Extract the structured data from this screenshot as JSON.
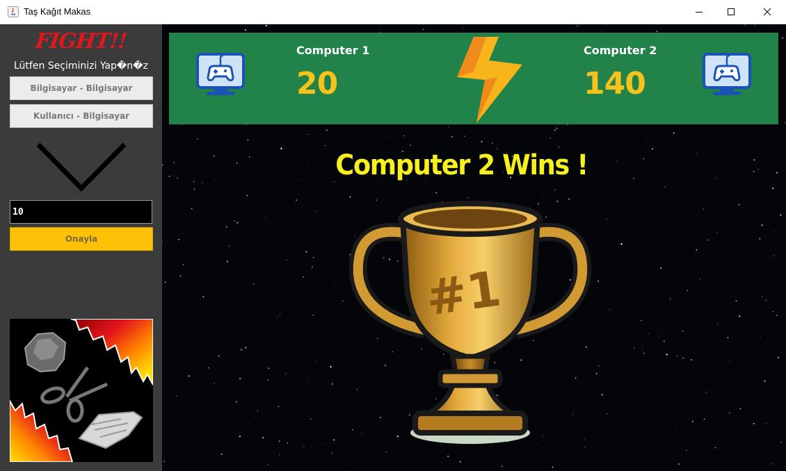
{
  "window": {
    "title": "Taş Kağıt Makas",
    "controls": [
      "minimize-icon",
      "maximize-icon",
      "close-icon"
    ]
  },
  "sidebar": {
    "fight_label": "FIGHT!!",
    "prompt": "Lütfen Seçiminizi Yap�n�z",
    "buttons": {
      "computer_vs_computer": "Bilgisayar - Bilgisayar",
      "user_vs_computer": "Kullanıcı - Bilgisayar"
    },
    "rounds_input": {
      "value": "10"
    },
    "confirm_label": "Onayla",
    "image_icon": "rock-scissors-paper-image"
  },
  "scoreboard": {
    "player1": {
      "name": "Computer 1",
      "score": "20",
      "icon": "monitor-gamepad-icon"
    },
    "player2": {
      "name": "Computer 2",
      "score": "140",
      "icon": "monitor-gamepad-icon"
    },
    "center_icon": "lightning-bolt-icon"
  },
  "result": {
    "text": "Computer 2 Wins !",
    "trophy_icon": "trophy-icon",
    "trophy_text": "#1"
  },
  "colors": {
    "scoreboard_bg": "#21824a",
    "score_color": "#f7c21b",
    "winner_color": "#f7f01b",
    "confirm_bg": "#ffc107",
    "fight_color": "#e3161c",
    "sidebar_bg": "#3b3b3b"
  }
}
